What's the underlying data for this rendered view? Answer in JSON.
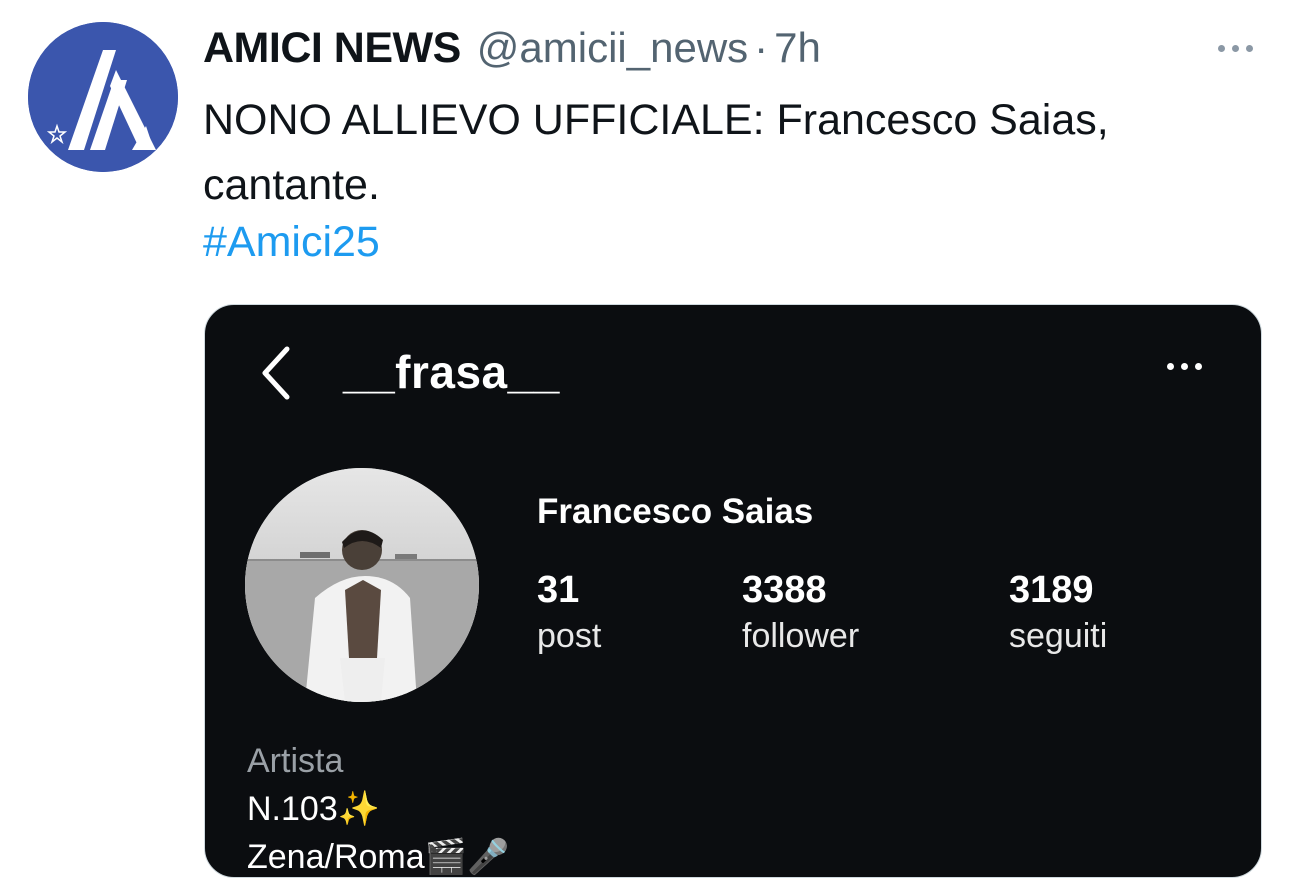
{
  "tweet": {
    "author_name": "AMICI NEWS",
    "handle": "@amicii_news",
    "separator": "·",
    "time": "7h",
    "text": "NONO ALLIEVO UFFICIALE: Francesco Saias, cantante.",
    "hashtag": "#Amici25",
    "more_icon": "more-horizontal-icon",
    "accent_color": "#1d9bf0",
    "avatar_color": "#3b56ad"
  },
  "instagram_screenshot": {
    "back_icon": "chevron-left-icon",
    "username": "__frasa__",
    "more_icon": "more-horizontal-icon",
    "full_name": "Francesco Saias",
    "stats": [
      {
        "value": "31",
        "label": "post"
      },
      {
        "value": "3388",
        "label": "follower"
      },
      {
        "value": "3189",
        "label": "seguiti"
      }
    ],
    "bio": {
      "category": "Artista",
      "line1": "N.103✨",
      "line2": "Zena/Roma🎬🎤"
    },
    "background_color": "#0b0d10"
  }
}
